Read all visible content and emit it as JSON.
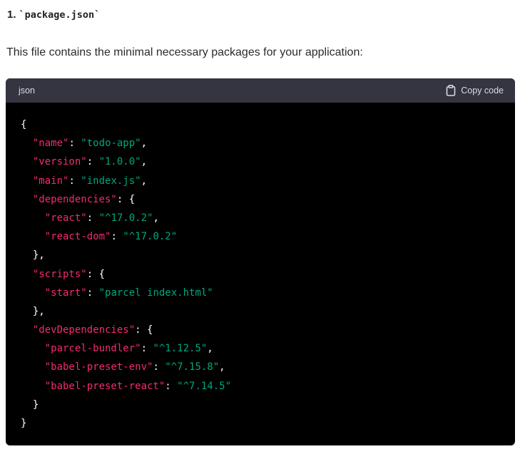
{
  "heading": {
    "number": "1.",
    "code": "`package.json`"
  },
  "intro": "This file contains the minimal necessary packages for your application:",
  "code_block": {
    "language": "json",
    "copy_label": "Copy code",
    "copy_icon": "clipboard-icon",
    "colors": {
      "header_bg": "#343541",
      "body_bg": "#000000",
      "key": "#f22c6d",
      "string": "#00a67d",
      "punctuation": "#ffffff"
    },
    "lines": [
      [
        {
          "t": "{",
          "k": "punc"
        }
      ],
      [
        {
          "t": "  ",
          "k": "punc"
        },
        {
          "t": "\"name\"",
          "k": "key"
        },
        {
          "t": ": ",
          "k": "punc"
        },
        {
          "t": "\"todo-app\"",
          "k": "str"
        },
        {
          "t": ",",
          "k": "punc"
        }
      ],
      [
        {
          "t": "  ",
          "k": "punc"
        },
        {
          "t": "\"version\"",
          "k": "key"
        },
        {
          "t": ": ",
          "k": "punc"
        },
        {
          "t": "\"1.0.0\"",
          "k": "str"
        },
        {
          "t": ",",
          "k": "punc"
        }
      ],
      [
        {
          "t": "  ",
          "k": "punc"
        },
        {
          "t": "\"main\"",
          "k": "key"
        },
        {
          "t": ": ",
          "k": "punc"
        },
        {
          "t": "\"index.js\"",
          "k": "str"
        },
        {
          "t": ",",
          "k": "punc"
        }
      ],
      [
        {
          "t": "  ",
          "k": "punc"
        },
        {
          "t": "\"dependencies\"",
          "k": "key"
        },
        {
          "t": ": {",
          "k": "punc"
        }
      ],
      [
        {
          "t": "    ",
          "k": "punc"
        },
        {
          "t": "\"react\"",
          "k": "key"
        },
        {
          "t": ": ",
          "k": "punc"
        },
        {
          "t": "\"^17.0.2\"",
          "k": "str"
        },
        {
          "t": ",",
          "k": "punc"
        }
      ],
      [
        {
          "t": "    ",
          "k": "punc"
        },
        {
          "t": "\"react-dom\"",
          "k": "key"
        },
        {
          "t": ": ",
          "k": "punc"
        },
        {
          "t": "\"^17.0.2\"",
          "k": "str"
        }
      ],
      [
        {
          "t": "  },",
          "k": "punc"
        }
      ],
      [
        {
          "t": "  ",
          "k": "punc"
        },
        {
          "t": "\"scripts\"",
          "k": "key"
        },
        {
          "t": ": {",
          "k": "punc"
        }
      ],
      [
        {
          "t": "    ",
          "k": "punc"
        },
        {
          "t": "\"start\"",
          "k": "key"
        },
        {
          "t": ": ",
          "k": "punc"
        },
        {
          "t": "\"parcel index.html\"",
          "k": "str"
        }
      ],
      [
        {
          "t": "  },",
          "k": "punc"
        }
      ],
      [
        {
          "t": "  ",
          "k": "punc"
        },
        {
          "t": "\"devDependencies\"",
          "k": "key"
        },
        {
          "t": ": {",
          "k": "punc"
        }
      ],
      [
        {
          "t": "    ",
          "k": "punc"
        },
        {
          "t": "\"parcel-bundler\"",
          "k": "key"
        },
        {
          "t": ": ",
          "k": "punc"
        },
        {
          "t": "\"^1.12.5\"",
          "k": "str"
        },
        {
          "t": ",",
          "k": "punc"
        }
      ],
      [
        {
          "t": "    ",
          "k": "punc"
        },
        {
          "t": "\"babel-preset-env\"",
          "k": "key"
        },
        {
          "t": ": ",
          "k": "punc"
        },
        {
          "t": "\"^7.15.8\"",
          "k": "str"
        },
        {
          "t": ",",
          "k": "punc"
        }
      ],
      [
        {
          "t": "    ",
          "k": "punc"
        },
        {
          "t": "\"babel-preset-react\"",
          "k": "key"
        },
        {
          "t": ": ",
          "k": "punc"
        },
        {
          "t": "\"^7.14.5\"",
          "k": "str"
        }
      ],
      [
        {
          "t": "  }",
          "k": "punc"
        }
      ],
      [
        {
          "t": "}",
          "k": "punc"
        }
      ]
    ]
  }
}
